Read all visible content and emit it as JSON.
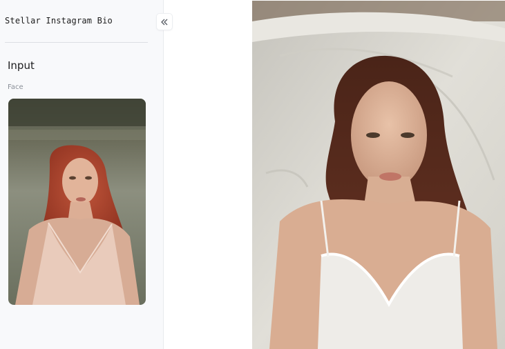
{
  "app": {
    "title": "Stellar Instagram Bio"
  },
  "sidebar": {
    "section_title": "Input",
    "face_label": "Face",
    "collapse_icon": "chevron-double-left-icon"
  },
  "colors": {
    "sidebar_bg": "#f8f9fb",
    "divider": "#dcdfe4",
    "text_primary": "#1d1d1f",
    "text_muted": "#8a8f98"
  }
}
